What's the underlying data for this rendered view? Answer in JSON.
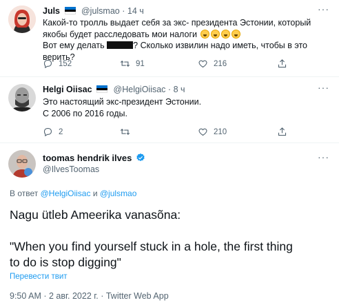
{
  "colors": {
    "accent": "#1d9bf0",
    "muted": "#536471",
    "text": "#0f1419"
  },
  "tweet1": {
    "name": "Juls",
    "handle": "@julsmao",
    "time": "14 ч",
    "line1": "Какой-то тролль выдает себя за экс- президента Эстонии, который",
    "line2": "якобы будет расследовать мои налоги",
    "line3_start": "Вот ему делать",
    "line3_end": "? Сколько извилин надо иметь, чтобы в это верить?",
    "replies": "152",
    "retweets": "91",
    "likes": "216"
  },
  "tweet2": {
    "name": "Helgi Oiisac",
    "handle": "@HelgiOiisac",
    "time": "8 ч",
    "line1": "Это настоящий экс-президент Эстонии.",
    "line2": "С 2006 по 2016 годы.",
    "replies": "2",
    "retweets": "",
    "likes": "210"
  },
  "main_tweet": {
    "name": "toomas hendrik ilves",
    "handle": "@IlvesToomas",
    "reply_prefix": "В ответ",
    "reply_user1": "@HelgiOiisac",
    "reply_and": "и",
    "reply_user2": "@julsmao",
    "text_line1": "Nagu ütleb Ameerika vanasõna:",
    "text_line2": "\"When you find yourself stuck in a hole, the first thing",
    "text_line3": "to do is stop digging\"",
    "translate": "Перевести твит",
    "meta": "9:50 AM · 2 авг. 2022 г. · Twitter Web App"
  },
  "icons": [
    "more-icon",
    "reply-icon",
    "retweet-icon",
    "like-icon",
    "share-icon",
    "verified-icon",
    "estonia-flag-icon",
    "emoji-icon"
  ]
}
